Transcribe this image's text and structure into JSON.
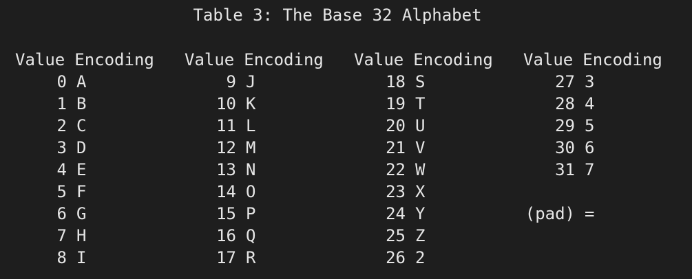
{
  "title": "Table 3: The Base 32 Alphabet",
  "header": {
    "value": "Value",
    "encoding": "Encoding"
  },
  "columns": [
    {
      "rows": [
        {
          "v": "0",
          "e": "A"
        },
        {
          "v": "1",
          "e": "B"
        },
        {
          "v": "2",
          "e": "C"
        },
        {
          "v": "3",
          "e": "D"
        },
        {
          "v": "4",
          "e": "E"
        },
        {
          "v": "5",
          "e": "F"
        },
        {
          "v": "6",
          "e": "G"
        },
        {
          "v": "7",
          "e": "H"
        },
        {
          "v": "8",
          "e": "I"
        }
      ]
    },
    {
      "rows": [
        {
          "v": "9",
          "e": "J"
        },
        {
          "v": "10",
          "e": "K"
        },
        {
          "v": "11",
          "e": "L"
        },
        {
          "v": "12",
          "e": "M"
        },
        {
          "v": "13",
          "e": "N"
        },
        {
          "v": "14",
          "e": "O"
        },
        {
          "v": "15",
          "e": "P"
        },
        {
          "v": "16",
          "e": "Q"
        },
        {
          "v": "17",
          "e": "R"
        }
      ]
    },
    {
      "rows": [
        {
          "v": "18",
          "e": "S"
        },
        {
          "v": "19",
          "e": "T"
        },
        {
          "v": "20",
          "e": "U"
        },
        {
          "v": "21",
          "e": "V"
        },
        {
          "v": "22",
          "e": "W"
        },
        {
          "v": "23",
          "e": "X"
        },
        {
          "v": "24",
          "e": "Y"
        },
        {
          "v": "25",
          "e": "Z"
        },
        {
          "v": "26",
          "e": "2"
        }
      ]
    },
    {
      "rows": [
        {
          "v": "27",
          "e": "3"
        },
        {
          "v": "28",
          "e": "4"
        },
        {
          "v": "29",
          "e": "5"
        },
        {
          "v": "30",
          "e": "6"
        },
        {
          "v": "31",
          "e": "7"
        },
        {
          "v": "",
          "e": ""
        },
        {
          "v": "(pad)",
          "e": "="
        }
      ]
    }
  ]
}
